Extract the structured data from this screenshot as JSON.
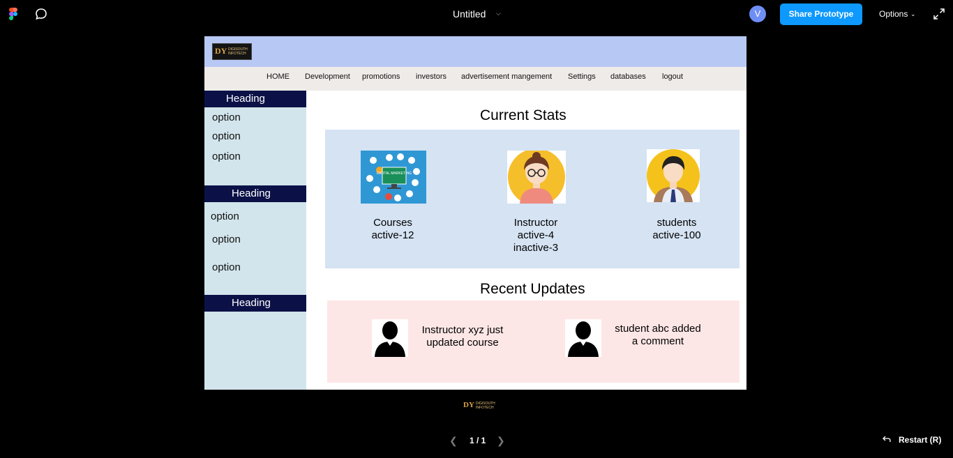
{
  "toolbar": {
    "title": "Untitled",
    "avatar_initial": "V",
    "share_label": "Share Prototype",
    "options_label": "Options"
  },
  "header": {
    "logo_mark": "DY",
    "logo_text": "DIGISOUTH INFOTECH"
  },
  "nav": {
    "items": [
      "HOME",
      "Development",
      "promotions",
      "investors",
      "advertisement mangement",
      "Settings",
      "databases",
      "logout"
    ]
  },
  "sidebar": {
    "sections": [
      {
        "heading": "Heading",
        "options": [
          "option",
          "option",
          "option"
        ]
      },
      {
        "heading": "Heading",
        "options": [
          "option",
          "option",
          "option"
        ]
      },
      {
        "heading": "Heading",
        "options": []
      }
    ]
  },
  "stats": {
    "title": "Current Stats",
    "cards": [
      {
        "image_label": "DIGITAL MARKETING",
        "lines": [
          "Courses",
          "active-12"
        ]
      },
      {
        "lines": [
          "Instructor",
          "active-4",
          "inactive-3"
        ]
      },
      {
        "lines": [
          "students",
          "active-100"
        ]
      }
    ]
  },
  "updates": {
    "title": "Recent Updates",
    "items": [
      {
        "lines": [
          "Instructor xyz just",
          "updated course"
        ]
      },
      {
        "lines": [
          "student abc added",
          "a comment"
        ]
      }
    ]
  },
  "footer": {
    "pager": "1 / 1",
    "restart_label": "Restart (R)"
  },
  "colors": {
    "share_button": "#0d99ff",
    "header_bg": "#b8c8f4",
    "sidebar_heading_bg": "#0b1147",
    "sidebar_bg": "#d2e5ec",
    "stats_bg": "#d5e3f3",
    "updates_bg": "#fde7e6"
  },
  "icons": {
    "app_logo": "figma-logo-icon",
    "comment": "comment-icon",
    "expand": "expand-icon",
    "restart": "restart-arrow-icon"
  }
}
